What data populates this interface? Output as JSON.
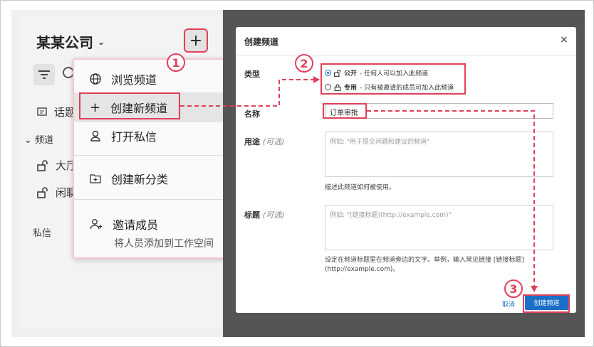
{
  "sidebar": {
    "workspace_name": "某某公司",
    "add_symbol": "+",
    "topics_label": "话题",
    "channels_section": "频道",
    "channel_1": "大厅",
    "channel_2": "闲聊",
    "dm_section": "私信"
  },
  "menu": {
    "browse": "浏览频道",
    "create_channel": "创建新频道",
    "open_dm": "打开私信",
    "create_category": "创建新分类",
    "invite": "邀请成员",
    "invite_sub": "将人员添加到工作空间"
  },
  "modal": {
    "title": "创建频道",
    "close": "×",
    "type_label": "类型",
    "public_label": "公开",
    "public_desc": " - 任何人可以加入此频道",
    "private_label": "专用",
    "private_desc": " - 只有被邀请的成员可加入此频道",
    "name_label": "名称",
    "name_value": "订单审批",
    "purpose_label": "用途",
    "optional": "(可选)",
    "purpose_placeholder": "例如: \"用于提交问题和建议的频道\"",
    "purpose_help": "描述此频道如何被使用。",
    "header_label": "标题",
    "header_placeholder": "例如: \"[链接标题](http://example.com)\"",
    "header_help": "设定在频道标题里在频道旁边的文字。举例，输入常见链接 [链接标题](http://example.com)。",
    "cancel": "取消",
    "create": "创建频道"
  },
  "annotations": {
    "step1": "1",
    "step2": "2",
    "step3": "3"
  },
  "colors": {
    "annotation_red": "#e0405a",
    "primary_blue": "#1b6fc8",
    "backdrop": "#555555"
  }
}
